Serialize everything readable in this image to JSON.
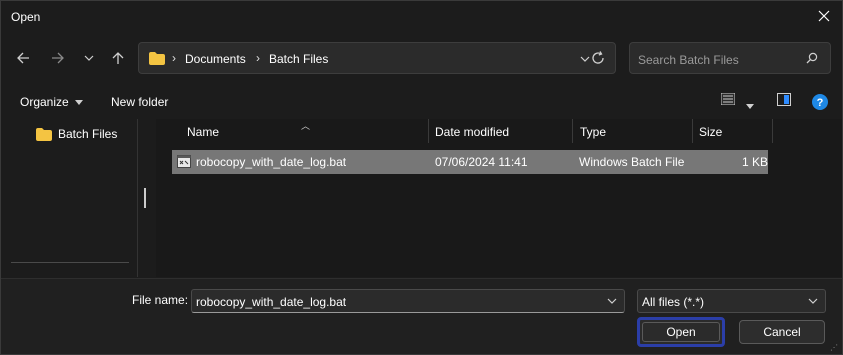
{
  "window": {
    "title": "Open"
  },
  "nav": {
    "breadcrumbs": [
      "Documents",
      "Batch Files"
    ],
    "search_placeholder": "Search Batch Files"
  },
  "toolbar": {
    "organize_label": "Organize",
    "new_folder_label": "New folder"
  },
  "tree": {
    "items": [
      {
        "label": "Batch Files"
      }
    ]
  },
  "filelist": {
    "columns": {
      "name": "Name",
      "date": "Date modified",
      "type": "Type",
      "size": "Size"
    },
    "rows": [
      {
        "name": "robocopy_with_date_log.bat",
        "date": "07/06/2024 11:41",
        "type": "Windows Batch File",
        "size": "1 KB"
      }
    ]
  },
  "footer": {
    "file_name_label": "File name:",
    "file_name_value": "robocopy_with_date_log.bat",
    "filter_value": "All files (*.*)",
    "open_label": "Open",
    "cancel_label": "Cancel"
  },
  "colors": {
    "folder": "#f4c442",
    "help": "#1e88e5",
    "focus": "#2b3ea8",
    "selected_row": "#777777"
  }
}
